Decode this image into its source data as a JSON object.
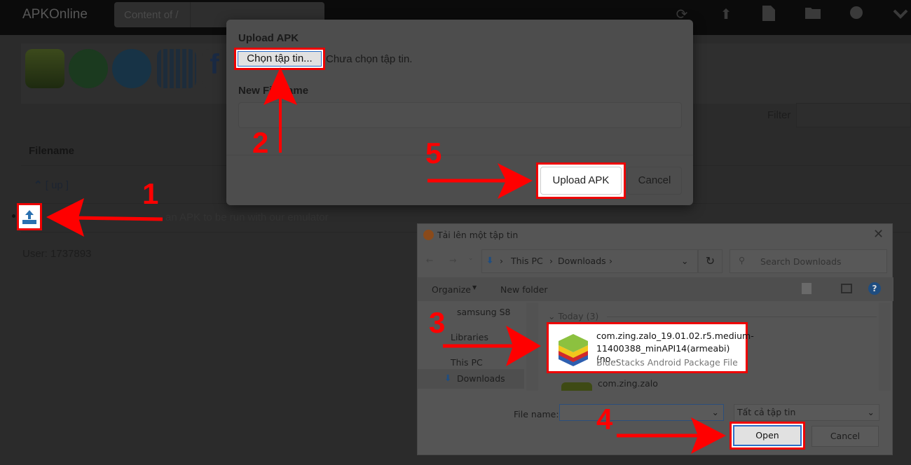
{
  "header": {
    "brand": "APKOnline",
    "content_label": "Content of /",
    "icons": [
      "refresh-icon",
      "upload-icon",
      "file-icon",
      "folder-icon",
      "globe-icon",
      "chevron-down-icon"
    ]
  },
  "app_icons": [
    "angry-birds",
    "whatsapp",
    "telegram",
    "spreadsheet-app",
    "facebook"
  ],
  "filter": {
    "label": "Filter",
    "value": ""
  },
  "table": {
    "header": "Filename",
    "up_label": "[ up ]",
    "row_text": "an APK to be run with our emulator"
  },
  "user": "User: 1737893",
  "modal": {
    "title": "Upload APK",
    "choose_button": "Chọn tập tin...",
    "no_file": "Chưa chọn tập tin.",
    "new_filename_label": "New Filename",
    "new_filename_value": "",
    "upload_button": "Upload APK",
    "cancel_button": "Cancel"
  },
  "file_dialog": {
    "title": "Tải lên một tập tin",
    "path": [
      "This PC",
      "Downloads"
    ],
    "search_placeholder": "Search Downloads",
    "organize": "Organize",
    "new_folder": "New folder",
    "nav": [
      "samsung S8",
      "Libraries",
      "This PC",
      "Downloads"
    ],
    "group": "Today (3)",
    "files": [
      {
        "name_line1": "com.zing.zalo_19.01.02.r5.medium-",
        "name_line2": "11400388_minAPI14(armeabi)(no...",
        "type": "BlueStacks Android Package File"
      },
      {
        "name_line1": "com.zing.zalo"
      }
    ],
    "file_name_label": "File name:",
    "file_name_value": "",
    "file_type": "Tất cả tập tin",
    "open_button": "Open",
    "cancel_button": "Cancel"
  },
  "annotations": {
    "step1": "1",
    "step2": "2",
    "step3": "3",
    "step4": "4",
    "step5": "5",
    "color": "#ff0000"
  }
}
